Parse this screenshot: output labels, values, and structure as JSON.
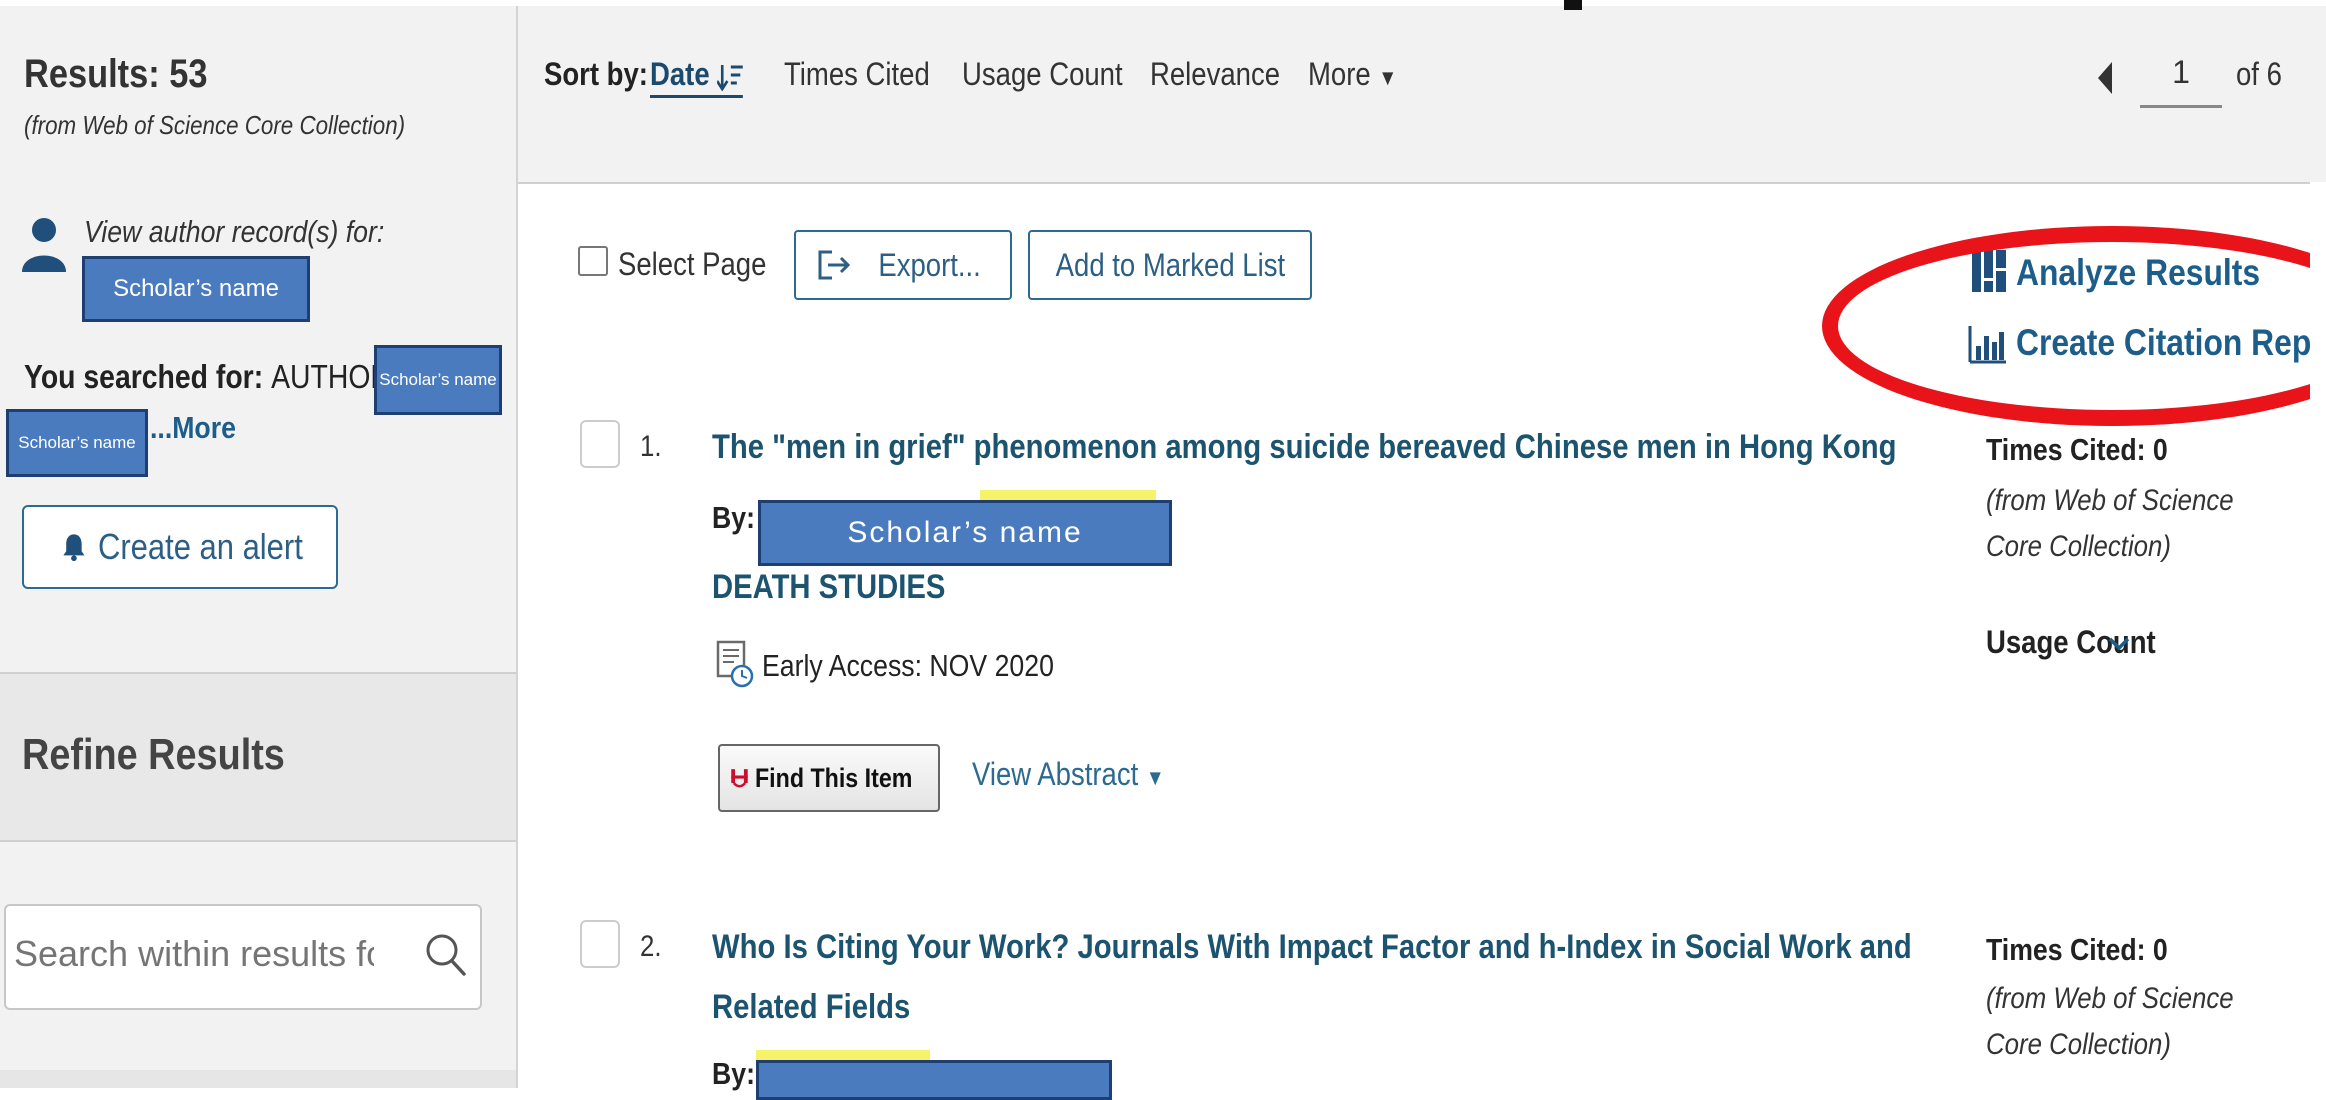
{
  "sidebar": {
    "results_count": "Results: 53",
    "results_source": "(from Web of Science Core Collection)",
    "view_author": "View author record(s) for:",
    "scholar_placeholder": "Scholar’s name",
    "searched_for_label": "You searched for:",
    "searched_for_value": "AUTHOR:",
    "more_link": "...More",
    "alert_button": "Create an alert",
    "refine_title": "Refine Results",
    "search_placeholder": "Search within results for..."
  },
  "sortbar": {
    "label": "Sort by:",
    "date": "Date",
    "times_cited": "Times Cited",
    "usage_count": "Usage Count",
    "relevance": "Relevance",
    "more": "More",
    "page_current": "1",
    "page_of": "of 6"
  },
  "toolbar": {
    "select_page": "Select Page",
    "export": "Export...",
    "add_marked": "Add to Marked List",
    "analyze": "Analyze Results",
    "citation_report": "Create Citation Repor"
  },
  "records": [
    {
      "num": "1.",
      "title_lines": [
        "The \"men in grief\" phenomenon among suicide bereaved Chinese men in Hong Kong"
      ],
      "by": "By:",
      "author": "Scholar’s name",
      "journal": "DEATH STUDIES",
      "early_access": "Early Access: NOV 2020",
      "find_item": "Find This Item",
      "view_abstract": "View Abstract",
      "times_cited": "Times Cited: 0",
      "cited_source": "(from Web of Science Core Collection)",
      "usage_count": "Usage Count"
    },
    {
      "num": "2.",
      "title_lines": [
        "Who Is Citing Your Work? Journals With Impact Factor and h-Index in Social Work and",
        "Related Fields"
      ],
      "by": "By:",
      "times_cited": "Times Cited: 0",
      "cited_source": "(from Web of Science Core Collection)"
    }
  ],
  "colors": {
    "link": "#1c5470",
    "accent_button": "#2c6a8f",
    "highlight_circle": "#e8141a",
    "redaction": "#4a7bbf"
  }
}
